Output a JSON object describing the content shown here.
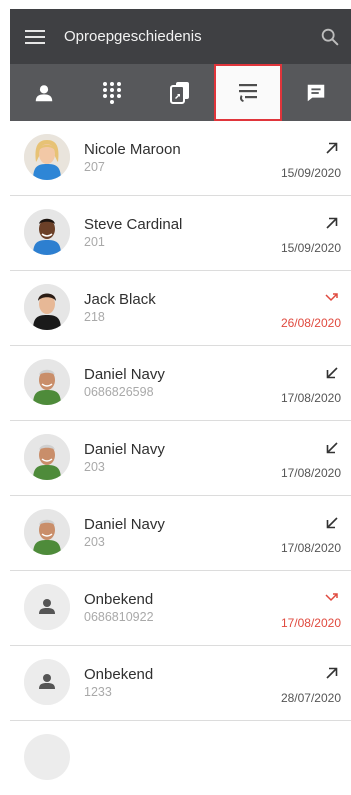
{
  "header": {
    "title": "Oproepgeschiedenis",
    "menu_icon": "hamburger-menu-icon",
    "search_icon": "search-icon"
  },
  "tabs": [
    {
      "icon": "person-icon"
    },
    {
      "icon": "dialpad-icon"
    },
    {
      "icon": "copy-icon"
    },
    {
      "icon": "call-history-icon",
      "active": true
    },
    {
      "icon": "chat-icon"
    }
  ],
  "colors": {
    "topbar": "#3f4043",
    "tabbar": "#57585b",
    "accent": "#e0353b",
    "missed": "#e04a3f"
  },
  "calls": [
    {
      "name": "Nicole Maroon",
      "number": "207",
      "date": "15/09/2020",
      "direction": "outgoing"
    },
    {
      "name": "Steve Cardinal",
      "number": "201",
      "date": "15/09/2020",
      "direction": "outgoing"
    },
    {
      "name": "Jack Black",
      "number": "218",
      "date": "26/08/2020",
      "direction": "missed"
    },
    {
      "name": "Daniel Navy",
      "number": "0686826598",
      "date": "17/08/2020",
      "direction": "incoming"
    },
    {
      "name": "Daniel Navy",
      "number": "203",
      "date": "17/08/2020",
      "direction": "incoming"
    },
    {
      "name": "Daniel Navy",
      "number": "203",
      "date": "17/08/2020",
      "direction": "incoming"
    },
    {
      "name": "Onbekend",
      "number": "0686810922",
      "date": "17/08/2020",
      "direction": "missed"
    },
    {
      "name": "Onbekend",
      "number": "1233",
      "date": "28/07/2020",
      "direction": "outgoing"
    }
  ]
}
